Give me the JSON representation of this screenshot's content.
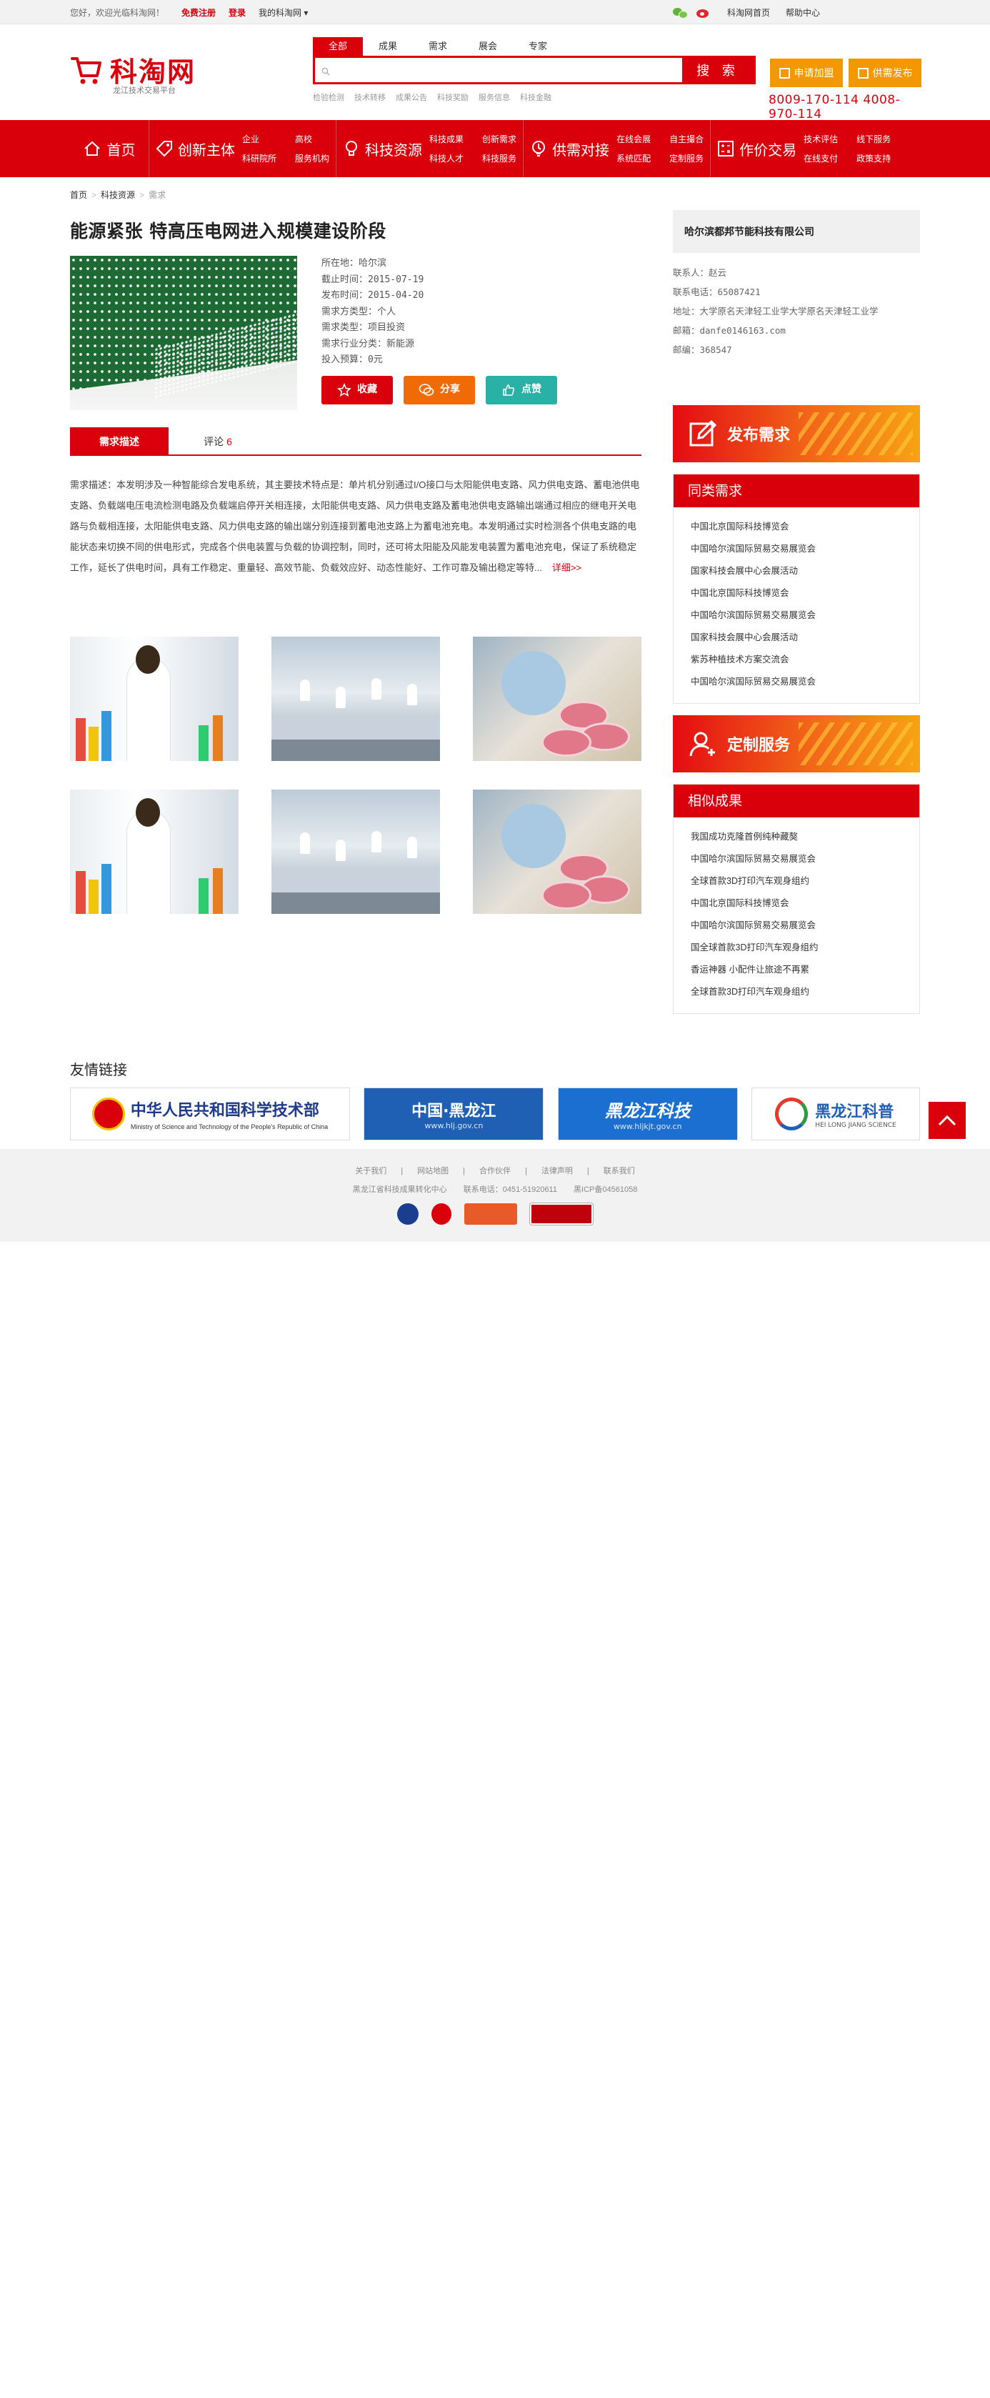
{
  "topbar": {
    "welcome": "您好，欢迎光临科淘网！",
    "register": "免费注册",
    "login": "登录",
    "mine": "我的科淘网",
    "home": "科淘网首页",
    "help": "帮助中心"
  },
  "logo": {
    "name": "科淘网",
    "slogan": "龙江技术交易平台"
  },
  "search": {
    "tabs": [
      "全部",
      "成果",
      "需求",
      "展会",
      "专家"
    ],
    "placeholder": "",
    "button": "搜 索",
    "hot": [
      "检验检测",
      "技术转移",
      "成果公告",
      "科技奖励",
      "服务信息",
      "科技金融"
    ]
  },
  "header_buttons": {
    "join": "申请加盟",
    "publish": "供需发布"
  },
  "phones": "8009-170-114  4008-970-114",
  "nav": {
    "home": "首页",
    "groups": [
      {
        "title": "创新主体",
        "links": [
          "企业",
          "高校",
          "科研院所",
          "服务机构"
        ]
      },
      {
        "title": "科技资源",
        "links": [
          "科技成果",
          "创新需求",
          "科技人才",
          "科技服务"
        ]
      },
      {
        "title": "供需对接",
        "links": [
          "在线会展",
          "自主撮合",
          "系统匹配",
          "定制服务"
        ]
      },
      {
        "title": "作价交易",
        "links": [
          "技术评估",
          "线下服务",
          "在线支付",
          "政策支持"
        ]
      }
    ]
  },
  "breadcrumb": [
    "首页",
    "科技资源",
    "需求"
  ],
  "demand": {
    "title": "能源紧张 特高压电网进入规模建设阶段",
    "meta": [
      "所在地：哈尔滨",
      "截止时间：2015-07-19",
      "发布时间：2015-04-20",
      "需求方类型：个人",
      "需求类型：项目投资",
      "需求行业分类：新能源",
      "投入预算：0元"
    ],
    "actions": [
      "收藏",
      "分享",
      "点赞"
    ],
    "tabs": {
      "desc": "需求描述",
      "comment": "评论",
      "comment_count": "6"
    },
    "description": "需求描述：本发明涉及一种智能综合发电系统，其主要技术特点是：单片机分别通过I/O接口与太阳能供电支路、风力供电支路、蓄电池供电支路、负载端电压电流检测电路及负载端启停开关相连接，太阳能供电支路、风力供电支路及蓄电池供电支路输出端通过相应的继电开关电路与负载相连接，太阳能供电支路、风力供电支路的输出端分别连接到蓄电池支路上为蓄电池充电。本发明通过实时检测各个供电支路的电能状态来切换不同的供电形式，完成各个供电装置与负载的协调控制，同时，还可将太阳能及风能发电装置为蓄电池充电，保证了系统稳定工作，延长了供电时间，具有工作稳定、重量轻、高效节能、负载效应好、动态性能好、工作可靠及输出稳定等特...",
    "more": "详细>>"
  },
  "company": {
    "name": "哈尔滨都邦节能科技有限公司",
    "contact": [
      "联系人：赵云",
      "联系电话：65087421",
      "地址：大学原名天津轻工业学大学原名天津轻工业学",
      "邮箱：danfe0146163.com",
      "邮编：368547"
    ]
  },
  "side": {
    "publish_banner": "发布需求",
    "same_title": "同类需求",
    "same": [
      "中国北京国际科技博览会",
      "中国哈尔滨国际贸易交易展览会",
      "国家科技会展中心会展活动",
      "中国北京国际科技博览会",
      "中国哈尔滨国际贸易交易展览会",
      "国家科技会展中心会展活动",
      "紫苏种植技术方案交流会",
      "中国哈尔滨国际贸易交易展览会"
    ],
    "custom_banner": "定制服务",
    "similar_title": "相似成果",
    "similar": [
      "我国成功克隆首例纯种藏獒",
      "中国哈尔滨国际贸易交易展览会",
      "全球首款3D打印汽车观身组约",
      "中国北京国际科技博览会",
      "中国哈尔滨国际贸易交易展览会",
      "国全球首款3D打印汽车观身组约",
      "香运神器 小配件让旅途不再累",
      "全球首款3D打印汽车观身组约"
    ]
  },
  "links": {
    "title": "友情链接",
    "items": [
      {
        "name": "中华人民共和国科学技术部",
        "sub": "Ministry of Science and Technology of the People's Republic of China"
      },
      {
        "name": "中国·黑龙江",
        "sub": "www.hlj.gov.cn"
      },
      {
        "name": "黑龙江科技",
        "sub": "www.hljkjt.gov.cn"
      },
      {
        "name": "黑龙江科普",
        "sub": "HEI LONG JIANG SCIENCE"
      }
    ]
  },
  "footer": {
    "links": [
      "关于我们",
      "|",
      "网站地图",
      "|",
      "合作伙伴",
      "|",
      "法律声明",
      "|",
      "联系我们"
    ],
    "org": "黑龙江省科技成果转化中心",
    "tel": "联系电话：0451-51920611",
    "icp": "黑ICP备04561058"
  }
}
